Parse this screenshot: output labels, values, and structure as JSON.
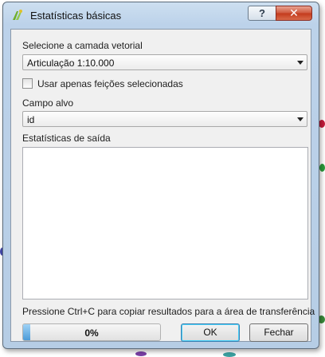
{
  "dialog": {
    "title": "Estatísticas básicas",
    "help_label": "?",
    "close_label": "✕"
  },
  "layer_section": {
    "label": "Selecione a camada vetorial",
    "selected": "Articulação 1:10.000"
  },
  "selected_only": {
    "label": "Usar apenas feições selecionadas",
    "checked": false
  },
  "field_section": {
    "label": "Campo alvo",
    "selected": "id"
  },
  "output_section": {
    "label": "Estatísticas de saída",
    "content": ""
  },
  "hint": "Pressione Ctrl+C para copiar resultados para a área de transferência",
  "progress": {
    "value": 0.05,
    "text": "0%"
  },
  "buttons": {
    "ok": "OK",
    "close": "Fechar"
  },
  "colors": {
    "title_bar": "#c4d8ef",
    "close_button": "#c94a2e",
    "progress_fill": "#4c9bd8",
    "dialog_body": "#f0f0f0"
  }
}
